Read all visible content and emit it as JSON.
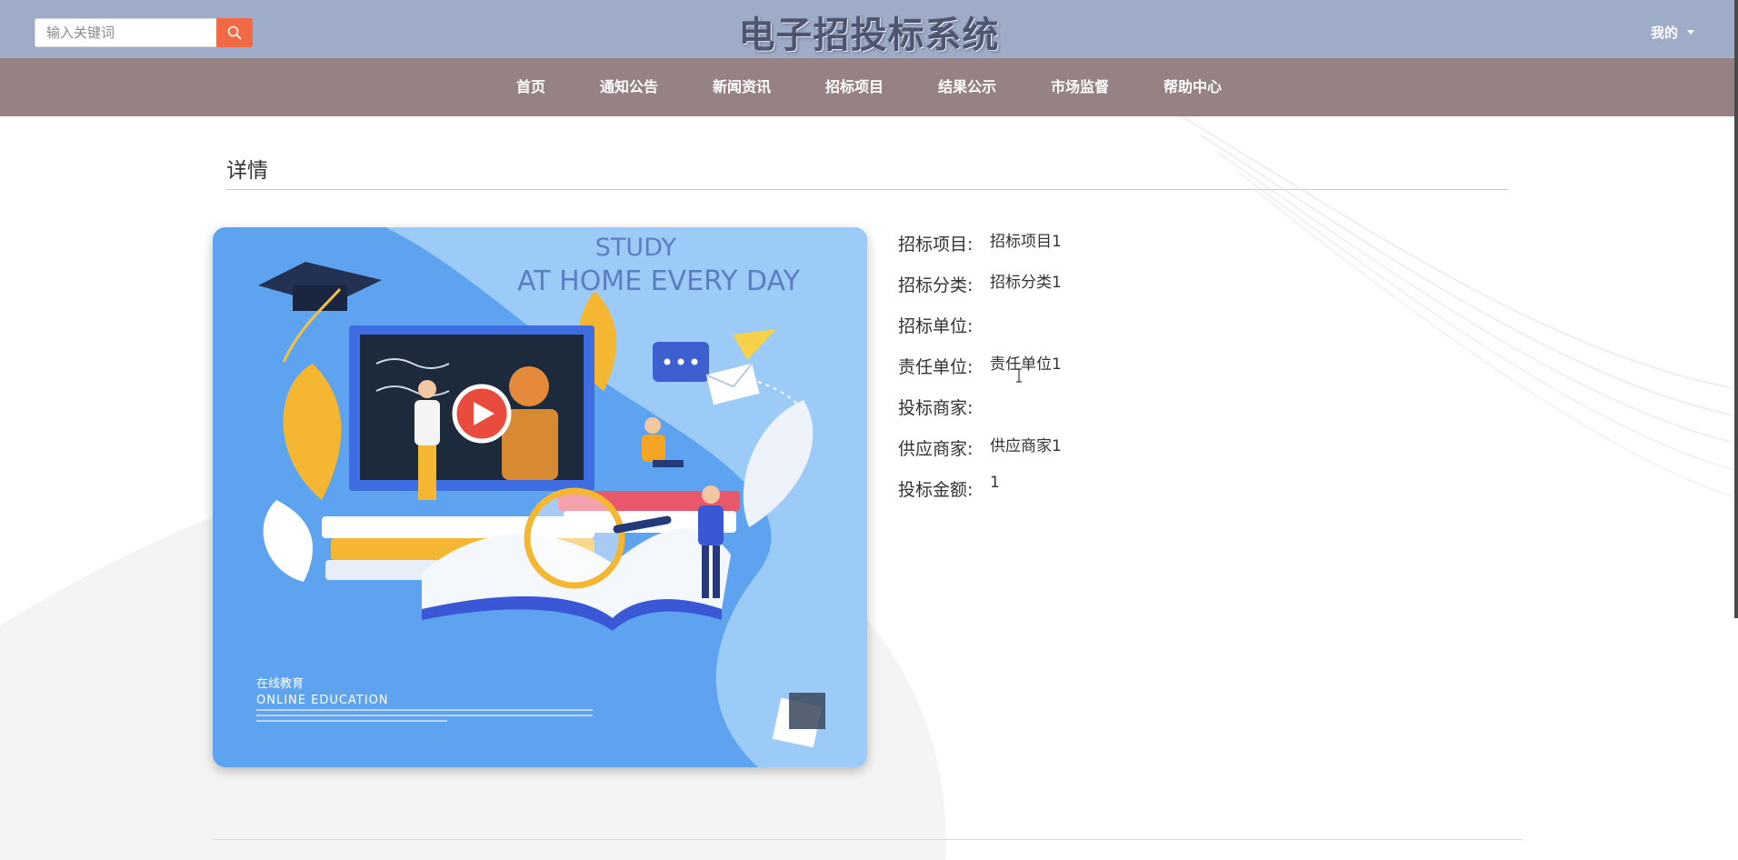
{
  "header": {
    "site_title": "电子招投标系统",
    "search": {
      "placeholder": "输入关键词",
      "value": ""
    },
    "user_menu_label": "我的"
  },
  "nav": {
    "items": [
      {
        "label": "首页"
      },
      {
        "label": "通知公告"
      },
      {
        "label": "新闻资讯"
      },
      {
        "label": "招标项目"
      },
      {
        "label": "结果公示"
      },
      {
        "label": "市场监督"
      },
      {
        "label": "帮助中心"
      }
    ]
  },
  "detail": {
    "section_title": "详情",
    "image": {
      "heading_line1": "STUDY",
      "heading_line2": "AT HOME EVERY DAY",
      "caption_cn": "在线教育",
      "caption_en": "ONLINE EDUCATION"
    },
    "fields": [
      {
        "label": "招标项目:",
        "value": "招标项目1"
      },
      {
        "label": "招标分类:",
        "value": "招标分类1"
      },
      {
        "label": "招标单位:",
        "value": ""
      },
      {
        "label": "责任单位:",
        "value": "责任单位1"
      },
      {
        "label": "投标商家:",
        "value": ""
      },
      {
        "label": "供应商家:",
        "value": "供应商家1"
      },
      {
        "label": "投标金额:",
        "value": "1"
      }
    ]
  },
  "colors": {
    "header_bg": "#9eacc8",
    "nav_bg": "#968282",
    "search_button": "#f26a43",
    "title_text": "#4d5570"
  },
  "icons": {
    "search_button": "search-icon",
    "user_menu": "caret-down-icon"
  }
}
